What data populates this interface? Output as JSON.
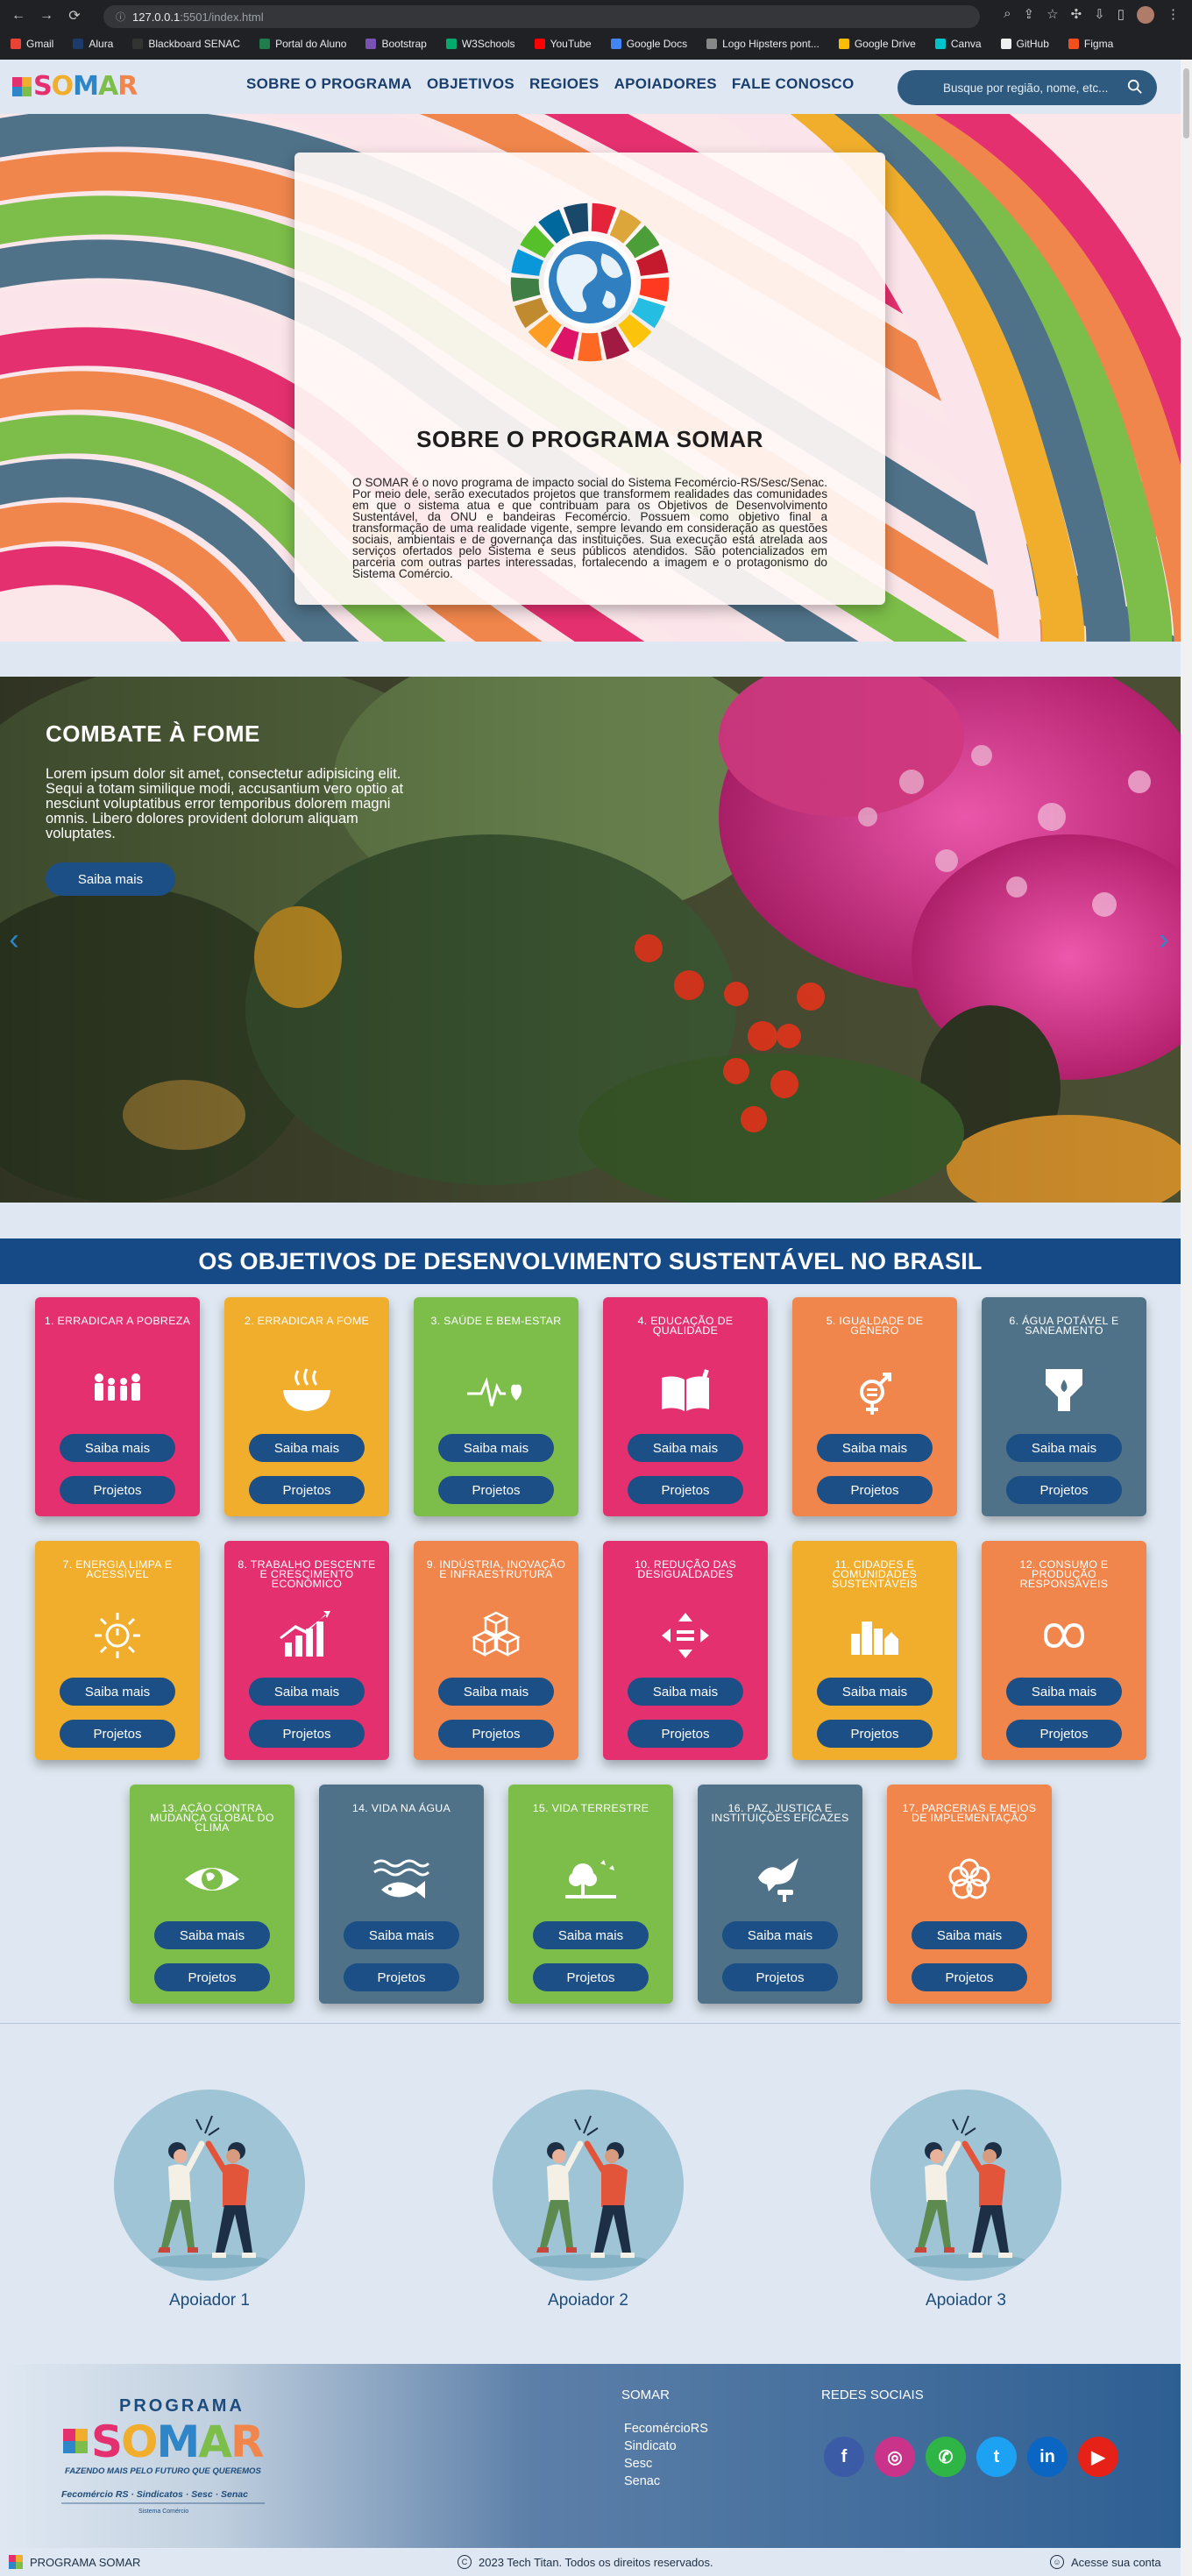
{
  "browser": {
    "url_host": "127.0.0.1",
    "url_path": ":5501/index.html",
    "bookmarks": [
      {
        "label": "Gmail",
        "color": "#ea4335"
      },
      {
        "label": "Alura",
        "color": "#1c3b6b"
      },
      {
        "label": "Blackboard SENAC",
        "color": "#333333"
      },
      {
        "label": "Portal do Aluno",
        "color": "#1e7d4a"
      },
      {
        "label": "Bootstrap",
        "color": "#7952b3"
      },
      {
        "label": "W3Schools",
        "color": "#04aa6d"
      },
      {
        "label": "YouTube",
        "color": "#ff0000"
      },
      {
        "label": "Google Docs",
        "color": "#4285f4"
      },
      {
        "label": "Logo Hipsters pont...",
        "color": "#888888"
      },
      {
        "label": "Google Drive",
        "color": "#fbbc04"
      },
      {
        "label": "Canva",
        "color": "#00c4cc"
      },
      {
        "label": "GitHub",
        "color": "#f0f0f0"
      },
      {
        "label": "Figma",
        "color": "#f24e1e"
      }
    ]
  },
  "header": {
    "logo_text": "SOMAR",
    "nav": [
      "SOBRE O PROGRAMA",
      "OBJETIVOS",
      "REGIOES",
      "APOIADORES",
      "FALE CONOSCO"
    ],
    "search_placeholder": "Busque por região, nome, etc..."
  },
  "about": {
    "title": "SOBRE O PROGRAMA SOMAR",
    "text": "O SOMAR é o novo programa de impacto social do Sistema Fecomércio-RS/Sesc/Senac. Por meio dele, serão executados projetos que transformem realidades das comunidades em que o sistema atua e que contribuam para os Objetivos de Desenvolvimento Sustentável, da ONU e bandeiras Fecomércio. Possuem como objetivo final a transformação de uma realidade vigente, sempre levando em consideração as questões sociais, ambientais e de governança das instituições. Sua execução está atrelada aos serviços ofertados pelo Sistema e seus públicos atendidos. São potencializados em parceria com outras partes interessadas, fortalecendo a imagem e o protagonismo do Sistema Comércio."
  },
  "carousel": {
    "title": "COMBATE À FOME",
    "text": "Lorem ipsum dolor sit amet, consectetur adipisicing elit. Sequi a totam similique modi, accusantium vero optio at nesciunt voluptatibus error temporibus dolorem magni omnis. Libero dolores provident dolorum aliquam voluptates.",
    "button": "Saiba mais"
  },
  "ods": {
    "heading": "OS OBJETIVOS DE DESENVOLVIMENTO SUSTENTÁVEL NO BRASIL",
    "btn_more": "Saiba mais",
    "btn_projects": "Projetos",
    "cards": [
      {
        "title": "1. ERRADICAR A POBREZA",
        "color": "#e5306f",
        "icon": "family-icon"
      },
      {
        "title": "2. ERRADICAR A FOME",
        "color": "#f0ae2c",
        "icon": "bowl-icon"
      },
      {
        "title": "3. SAÚDE E BEM-ESTAR",
        "color": "#7cbe49",
        "icon": "heartbeat-icon"
      },
      {
        "title": "4. EDUCAÇÃO DE QUALIDADE",
        "color": "#e5306f",
        "icon": "book-icon"
      },
      {
        "title": "5. IGUALDADE DE GÊNERO",
        "color": "#f0864c",
        "icon": "gender-icon"
      },
      {
        "title": "6. ÁGUA POTÁVEL E SANEAMENTO",
        "color": "#4f7289",
        "icon": "water-icon"
      },
      {
        "title": "7. ENERGIA LIMPA E ACESSÍVEL",
        "color": "#f0ae2c",
        "icon": "sun-power-icon"
      },
      {
        "title": "8. TRABALHO DESCENTE E CRESCIMENTO ECONÔMICO",
        "color": "#e5306f",
        "icon": "growth-chart-icon"
      },
      {
        "title": "9. INDÚSTRIA, INOVAÇÃO E INFRAESTRUTURA",
        "color": "#f0864c",
        "icon": "cubes-icon"
      },
      {
        "title": "10. REDUÇÃO DAS DESIGUALDADES",
        "color": "#e5306f",
        "icon": "equality-icon"
      },
      {
        "title": "11. CIDADES E COMUNIDADES SUSTENTÁVEIS",
        "color": "#f0ae2c",
        "icon": "city-icon"
      },
      {
        "title": "12. CONSUMO E PRODUÇÃO RESPONSÁVEIS",
        "color": "#f0864c",
        "icon": "infinity-icon"
      },
      {
        "title": "13. AÇÃO CONTRA MUDANÇA GLOBAL DO CLIMA",
        "color": "#7cbe49",
        "icon": "eye-globe-icon"
      },
      {
        "title": "14. VIDA NA ÁGUA",
        "color": "#4f7289",
        "icon": "fish-icon"
      },
      {
        "title": "15. VIDA TERRESTRE",
        "color": "#7cbe49",
        "icon": "tree-icon"
      },
      {
        "title": "16. PAZ, JUSTIÇA E INSTITUIÇÕES EFICAZES",
        "color": "#4f7289",
        "icon": "dove-icon"
      },
      {
        "title": "17. PARCERIAS E MEIOS DE IMPLEMENTAÇÃO",
        "color": "#f0864c",
        "icon": "flower-icon"
      }
    ]
  },
  "supporters": [
    {
      "label": "Apoiador 1"
    },
    {
      "label": "Apoiador 2"
    },
    {
      "label": "Apoiador 3"
    }
  ],
  "footer": {
    "logo_top": "PROGRAMA",
    "logo_main": "SOMAR",
    "logo_tagline": "FAZENDO MAIS PELO FUTURO QUE QUEREMOS",
    "logo_partners": "Fecomércio RS · Sindicatos · Sesc · Senac",
    "logo_system": "Sistema Comércio",
    "col1_title": "SOMAR",
    "col1_links": [
      "FecomércioRS",
      "Sindicato",
      "Sesc",
      "Senac"
    ],
    "col2_title": "REDES SOCIAIS",
    "socials": [
      {
        "name": "facebook",
        "glyph": "f",
        "color": "#3b5ba6"
      },
      {
        "name": "instagram",
        "glyph": "◎",
        "color": "#c9338a"
      },
      {
        "name": "whatsapp",
        "glyph": "✆",
        "color": "#2fb546"
      },
      {
        "name": "twitter",
        "glyph": "t",
        "color": "#1da1f2"
      },
      {
        "name": "linkedin",
        "glyph": "in",
        "color": "#0a66c2"
      },
      {
        "name": "youtube",
        "glyph": "▶",
        "color": "#e62117"
      }
    ]
  },
  "bottom_bar": {
    "brand": "PROGRAMA SOMAR",
    "copyright": "2023 Tech Titan. Todos os direitos reservados.",
    "account": "Acesse sua conta"
  }
}
